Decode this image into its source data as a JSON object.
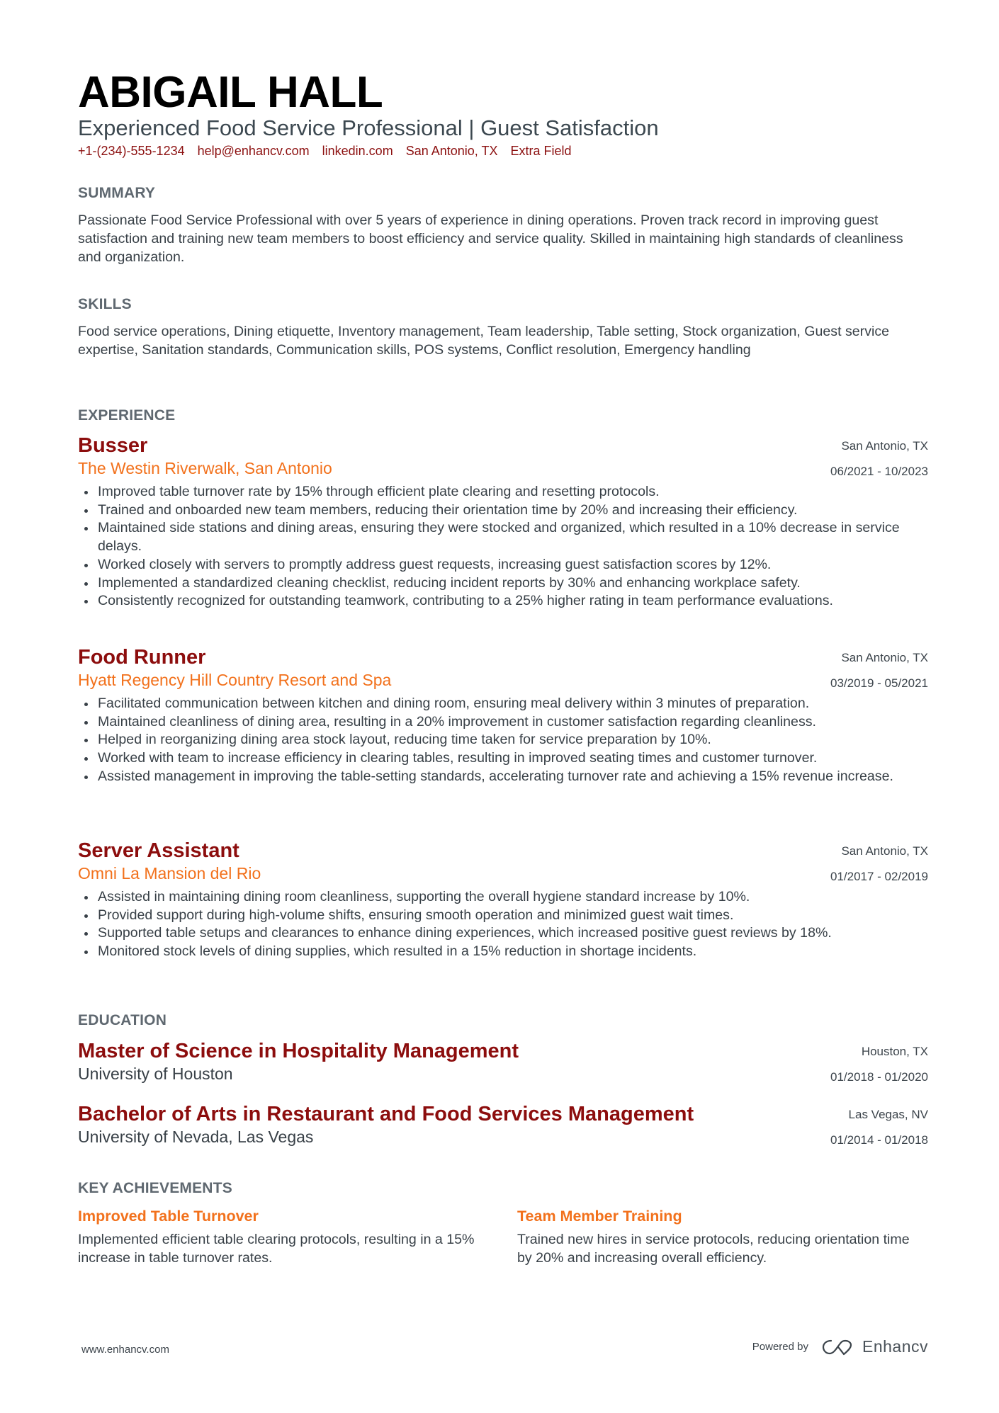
{
  "header": {
    "name": "ABIGAIL HALL",
    "subtitle": "Experienced Food Service Professional | Guest Satisfaction",
    "contacts": [
      "+1-(234)-555-1234",
      "help@enhancv.com",
      "linkedin.com",
      "San Antonio, TX",
      "Extra Field"
    ]
  },
  "summary": {
    "title": "SUMMARY",
    "text": "Passionate Food Service Professional with over 5 years of experience in dining operations. Proven track record in improving guest satisfaction and training new team members to boost efficiency and service quality. Skilled in maintaining high standards of cleanliness and organization."
  },
  "skills": {
    "title": "SKILLS",
    "text": "Food service operations, Dining etiquette, Inventory management, Team leadership, Table setting, Stock organization, Guest service expertise, Sanitation standards, Communication skills, POS systems, Conflict resolution, Emergency handling"
  },
  "experience": {
    "title": "EXPERIENCE",
    "jobs": [
      {
        "title": "Busser",
        "company": "The Westin Riverwalk, San Antonio",
        "location": "San Antonio, TX",
        "dates": "06/2021 - 10/2023",
        "bullets": [
          "Improved table turnover rate by 15% through efficient plate clearing and resetting protocols.",
          "Trained and onboarded new team members, reducing their orientation time by 20% and increasing their efficiency.",
          "Maintained side stations and dining areas, ensuring they were stocked and organized, which resulted in a 10% decrease in service delays.",
          "Worked closely with servers to promptly address guest requests, increasing guest satisfaction scores by 12%.",
          "Implemented a standardized cleaning checklist, reducing incident reports by 30% and enhancing workplace safety.",
          "Consistently recognized for outstanding teamwork, contributing to a 25% higher rating in team performance evaluations."
        ]
      },
      {
        "title": "Food Runner",
        "company": "Hyatt Regency Hill Country Resort and Spa",
        "location": "San Antonio, TX",
        "dates": "03/2019 - 05/2021",
        "bullets": [
          "Facilitated communication between kitchen and dining room, ensuring meal delivery within 3 minutes of preparation.",
          "Maintained cleanliness of dining area, resulting in a 20% improvement in customer satisfaction regarding cleanliness.",
          "Helped in reorganizing dining area stock layout, reducing time taken for service preparation by 10%.",
          "Worked with team to increase efficiency in clearing tables, resulting in improved seating times and customer turnover.",
          "Assisted management in improving the table-setting standards, accelerating turnover rate and achieving a 15% revenue increase."
        ]
      },
      {
        "title": "Server Assistant",
        "company": "Omni La Mansion del Rio",
        "location": "San Antonio, TX",
        "dates": "01/2017 - 02/2019",
        "bullets": [
          "Assisted in maintaining dining room cleanliness, supporting the overall hygiene standard increase by 10%.",
          "Provided support during high-volume shifts, ensuring smooth operation and minimized guest wait times.",
          "Supported table setups and clearances to enhance dining experiences, which increased positive guest reviews by 18%.",
          "Monitored stock levels of dining supplies, which resulted in a 15% reduction in shortage incidents."
        ]
      }
    ]
  },
  "education": {
    "title": "EDUCATION",
    "items": [
      {
        "degree": "Master of Science in Hospitality Management",
        "school": "University of Houston",
        "location": "Houston, TX",
        "dates": "01/2018 - 01/2020"
      },
      {
        "degree": "Bachelor of Arts in Restaurant and Food Services Management",
        "school": "University of Nevada, Las Vegas",
        "location": "Las Vegas, NV",
        "dates": "01/2014 - 01/2018"
      }
    ]
  },
  "achievements": {
    "title": "KEY ACHIEVEMENTS",
    "items": [
      {
        "title": "Improved Table Turnover",
        "description": "Implemented efficient table clearing protocols, resulting in a 15% increase in table turnover rates."
      },
      {
        "title": "Team Member Training",
        "description": "Trained new hires in service protocols, reducing orientation time by 20% and increasing overall efficiency."
      }
    ]
  },
  "footer": {
    "website": "www.enhancv.com",
    "powered_by": "Powered by",
    "brand": "Enhancv",
    "brand_icon": "enhancv-logo-icon"
  },
  "colors": {
    "accent_dark_red": "#8c0d0d",
    "accent_orange": "#f2711c",
    "heading_gray": "#5f6870",
    "body_text": "#384047"
  }
}
